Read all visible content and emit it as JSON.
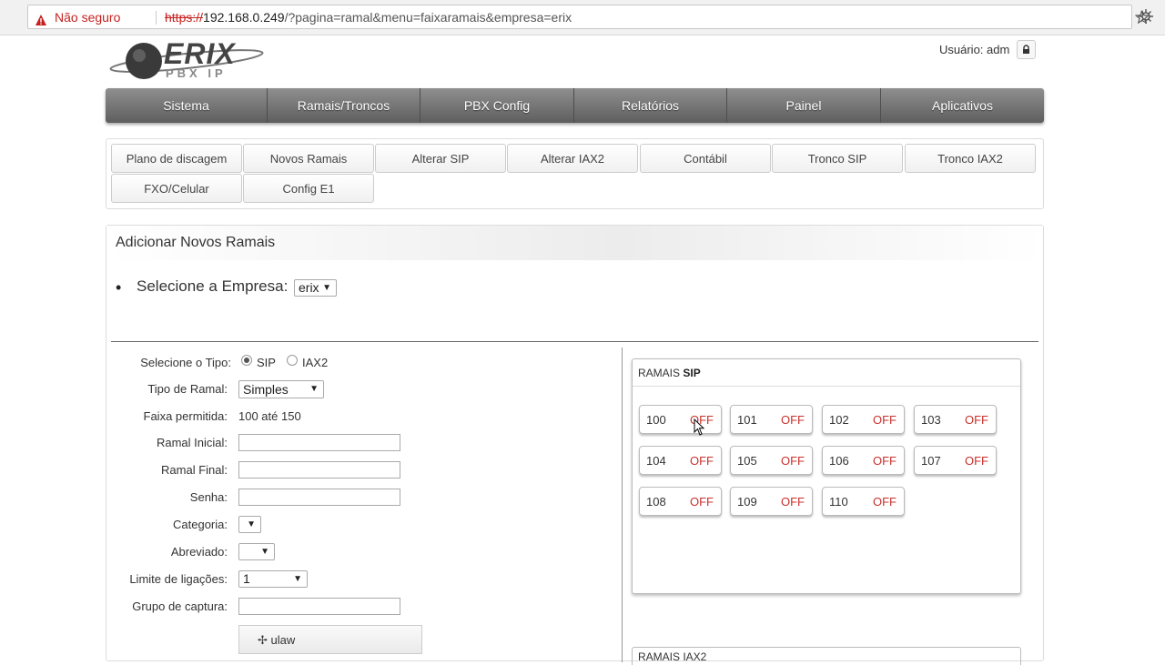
{
  "browser": {
    "security_text": "Não seguro",
    "url_protocol": "https://",
    "url_host": "192.168.0.249",
    "url_path": "/?pagina=ramal&menu=faixaramais&empresa=erix"
  },
  "header": {
    "logo_text": "ERIX",
    "logo_subtext": "PBX IP",
    "user_label": "Usuário: adm"
  },
  "main_nav": [
    "Sistema",
    "Ramais/Troncos",
    "PBX Config",
    "Relatórios",
    "Painel",
    "Aplicativos"
  ],
  "sub_nav": [
    "Plano de discagem",
    "Novos Ramais",
    "Alterar SIP",
    "Alterar IAX2",
    "Contábil",
    "Tronco SIP",
    "Tronco IAX2",
    "FXO/Celular",
    "Config E1"
  ],
  "panel": {
    "title": "Adicionar Novos Ramais",
    "empresa_label": "Selecione a Empresa:",
    "empresa_value": "erix"
  },
  "form": {
    "tipo_label": "Selecione o Tipo:",
    "tipo_sip": "SIP",
    "tipo_iax2": "IAX2",
    "tipo_ramal_label": "Tipo de Ramal:",
    "tipo_ramal_value": "Simples",
    "faixa_label": "Faixa permitida:",
    "faixa_value": "100 até 150",
    "ramal_inicial_label": "Ramal Inicial:",
    "ramal_final_label": "Ramal Final:",
    "senha_label": "Senha:",
    "categoria_label": "Categoria:",
    "abreviado_label": "Abreviado:",
    "limite_label": "Limite de ligações:",
    "limite_value": "1",
    "grupo_label": "Grupo de captura:",
    "codec_label": "ulaw"
  },
  "ramais_sip": {
    "title_prefix": "RAMAIS",
    "title_bold": "SIP",
    "items": [
      {
        "num": "100",
        "status": "OFF"
      },
      {
        "num": "101",
        "status": "OFF"
      },
      {
        "num": "102",
        "status": "OFF"
      },
      {
        "num": "103",
        "status": "OFF"
      },
      {
        "num": "104",
        "status": "OFF"
      },
      {
        "num": "105",
        "status": "OFF"
      },
      {
        "num": "106",
        "status": "OFF"
      },
      {
        "num": "107",
        "status": "OFF"
      },
      {
        "num": "108",
        "status": "OFF"
      },
      {
        "num": "109",
        "status": "OFF"
      },
      {
        "num": "110",
        "status": "OFF"
      }
    ]
  },
  "ramais_iax": {
    "title": "RAMAIS IAX2"
  },
  "colors": {
    "status_off": "#c9302c",
    "nav_bg": "#6e6e6e",
    "warning": "#c5221f"
  }
}
